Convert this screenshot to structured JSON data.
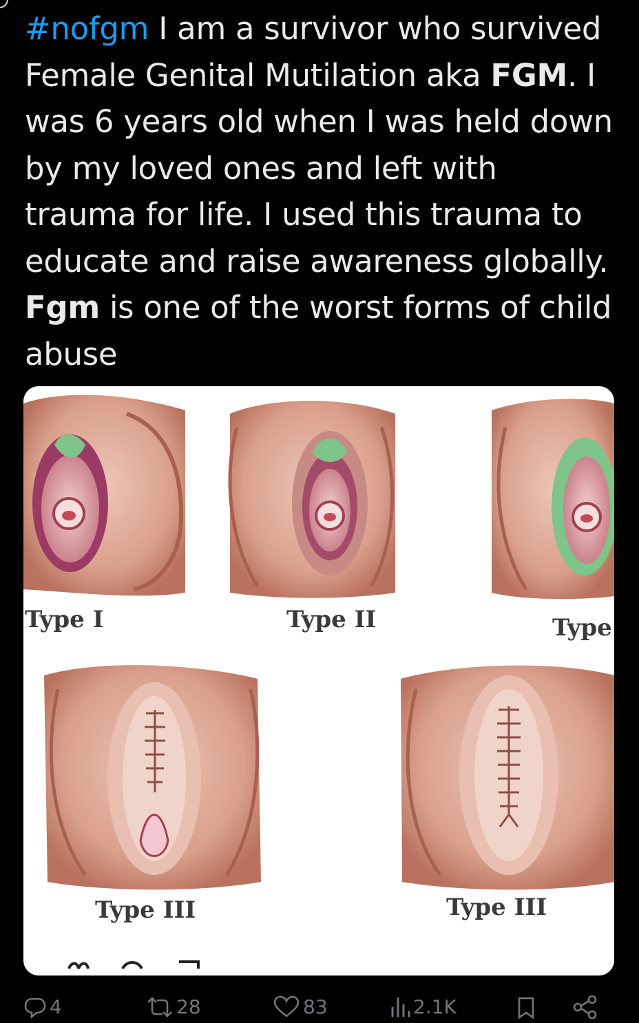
{
  "tweet": {
    "segments": [
      {
        "text": "#nofgm",
        "style": "hashtag"
      },
      {
        "text": " I am a survivor who survived Female Genital Mutilation aka ",
        "style": "normal"
      },
      {
        "text": "FGM",
        "style": "bold"
      },
      {
        "text": ".  I was 6 years old when I was held down by my loved ones and left with trauma for life.  I used this trauma to educate and raise awareness globally. ",
        "style": "normal"
      },
      {
        "text": "Fgm",
        "style": "bold"
      },
      {
        "text": " is one of the worst forms of child abuse",
        "style": "normal"
      }
    ]
  },
  "media": {
    "labels": {
      "type1": "Type I",
      "type2": "Type II",
      "type3_top": "Type",
      "type3_left": "Type III",
      "type3_right": "Type III"
    },
    "colors": {
      "skin": "#d9a08c",
      "skin_dark": "#b9725f",
      "labia": "#9b3b63",
      "green": "#7fc48a",
      "suture": "#8a4e44"
    }
  },
  "actions": {
    "replies": {
      "icon": "reply-icon",
      "count": "4"
    },
    "retweets": {
      "icon": "retweet-icon",
      "count": "28"
    },
    "likes": {
      "icon": "heart-icon",
      "count": "83"
    },
    "views": {
      "icon": "views-icon",
      "count": "2.1K"
    },
    "bookmark": {
      "icon": "bookmark-icon"
    },
    "share": {
      "icon": "share-icon"
    }
  }
}
